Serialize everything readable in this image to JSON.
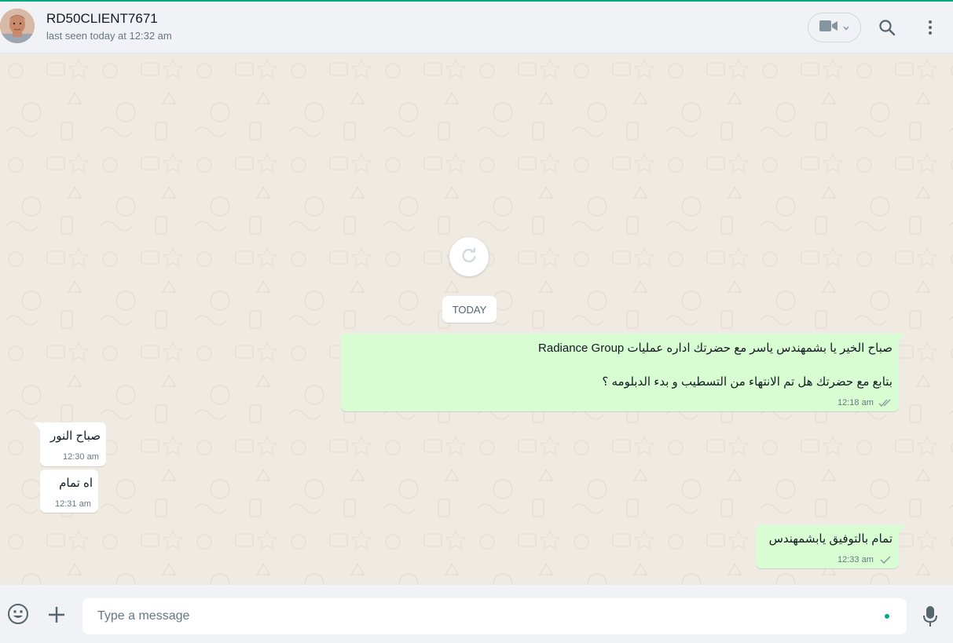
{
  "header": {
    "contact_name": "RD50CLIENT7671",
    "last_seen": "last seen today at 12:32 am",
    "icons": [
      "avatar",
      "video-call-icon",
      "chevron-down-icon",
      "search-icon",
      "menu-icon"
    ]
  },
  "chat": {
    "reload_icon": "refresh-icon",
    "date_divider": "TODAY",
    "messages": [
      {
        "direction": "outgoing",
        "lines": [
          "صباح الخير يا بشمهندس ياسر مع  حضرتك اداره عمليات Radiance Group",
          "بتابع مع حضرتك هل تم الانتهاء من التسطيب و بدء الدبلومه ؟"
        ],
        "time": "12:18 am",
        "status": "read"
      },
      {
        "direction": "incoming",
        "lines": [
          "صباح النور"
        ],
        "time": "12:30 am"
      },
      {
        "direction": "incoming",
        "lines": [
          "اه تمام"
        ],
        "time": "12:31 am"
      },
      {
        "direction": "outgoing",
        "lines": [
          "تمام بالتوفيق يابشمهندس"
        ],
        "time": "12:33 am",
        "status": "sent"
      }
    ]
  },
  "composer": {
    "placeholder": "Type a message",
    "icons": [
      "emoji-icon",
      "attach-icon",
      "mic-icon"
    ]
  },
  "colors": {
    "accent": "#00a884",
    "outgoing_bubble": "#d9fdd3",
    "incoming_bubble": "#ffffff",
    "chat_background": "#efeae2",
    "header_background": "#f0f2f5",
    "read_tick": "#667781"
  }
}
